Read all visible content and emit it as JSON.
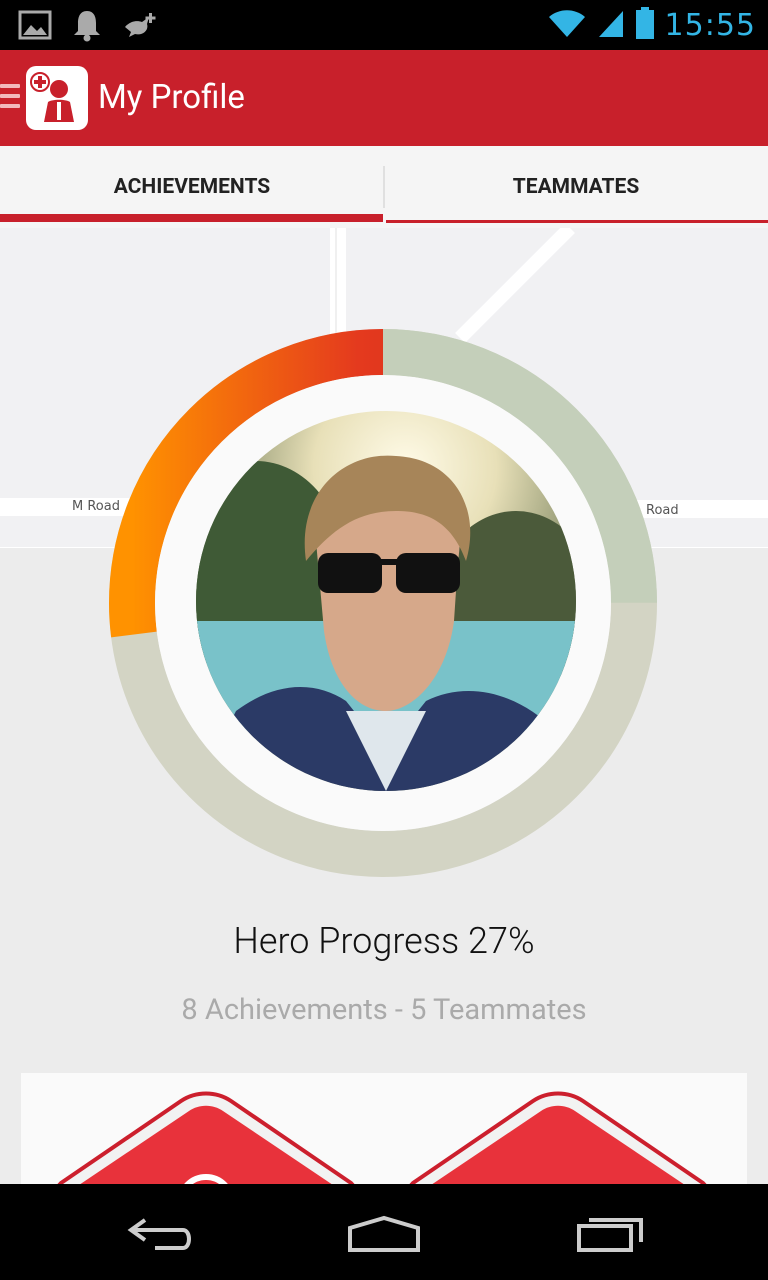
{
  "status_bar": {
    "time": "15:55",
    "icons": [
      "picture-icon",
      "notification-bell-icon",
      "bird-add-icon",
      "wifi-icon",
      "signal-icon",
      "battery-icon"
    ]
  },
  "action_bar": {
    "title": "My Profile",
    "app_icon": "hero-app-icon"
  },
  "tabs": [
    {
      "label": "ACHIEVEMENTS",
      "selected": true
    },
    {
      "label": "TEAMMATES",
      "selected": false
    }
  ],
  "map": {
    "road_labels": [
      "M Road",
      "Road"
    ]
  },
  "profile": {
    "progress_percent": 27,
    "progress_text": "Hero Progress 27%",
    "stats_text": "8 Achievements - 5 Teammates"
  },
  "colors": {
    "brand_red": "#c8202b",
    "status_blue": "#33b5e5",
    "ring_track": "#d3d4c4"
  },
  "nav_bar": {
    "buttons": [
      "back-icon",
      "home-icon",
      "recent-apps-icon"
    ]
  }
}
